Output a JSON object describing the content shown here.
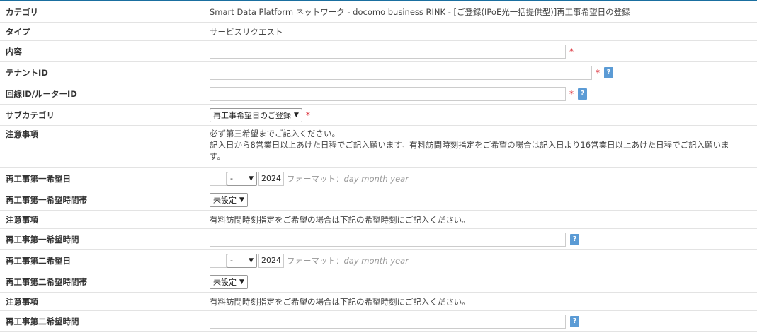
{
  "rows": {
    "category": {
      "label": "カテゴリ",
      "value": "Smart Data Platform ネットワーク - docomo business RINK - [ご登録(IPoE光一括提供型)]再工事希望日の登録"
    },
    "type": {
      "label": "タイプ",
      "value": "サービスリクエスト"
    },
    "content": {
      "label": "内容",
      "value": ""
    },
    "tenant_id": {
      "label": "テナントID",
      "value": ""
    },
    "line_id": {
      "label": "回線ID/ルーターID",
      "value": ""
    },
    "subcategory": {
      "label": "サブカテゴリ",
      "selected": "再工事希望日のご登録"
    },
    "note1": {
      "label": "注意事項",
      "lines": [
        "必ず第三希望までご記入ください。",
        "記入日から8営業日以上あけた日程でご記入願います。有料訪問時刻指定をご希望の場合は記入日より16営業日以上あけた日程でご記入願いま",
        "す。"
      ]
    },
    "first_date": {
      "label": "再工事第一希望日",
      "month": "-",
      "year": "2024",
      "format_prefix": "フォーマット：",
      "format": "day month year"
    },
    "first_band": {
      "label": "再工事第一希望時間帯",
      "selected": "未設定"
    },
    "note2": {
      "label": "注意事項",
      "text": "有料訪問時刻指定をご希望の場合は下記の希望時刻にご記入ください。"
    },
    "first_time": {
      "label": "再工事第一希望時間",
      "value": ""
    },
    "second_date": {
      "label": "再工事第二希望日",
      "month": "-",
      "year": "2024",
      "format_prefix": "フォーマット：",
      "format": "day month year"
    },
    "second_band": {
      "label": "再工事第二希望時間帯",
      "selected": "未設定"
    },
    "note3": {
      "label": "注意事項",
      "text": "有料訪問時刻指定をご希望の場合は下記の希望時刻にご記入ください。"
    },
    "second_time": {
      "label": "再工事第二希望時間",
      "value": ""
    }
  },
  "ui": {
    "required_mark": "*",
    "help_mark": "?"
  },
  "colors": {
    "accent": "#1a6fa0",
    "required": "#d9232d",
    "help": "#5b9bd5"
  }
}
